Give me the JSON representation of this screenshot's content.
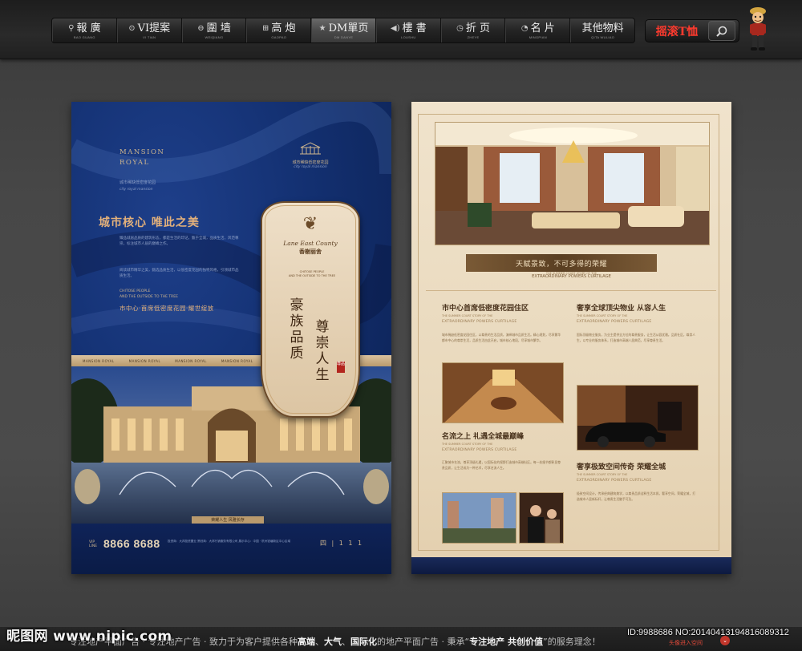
{
  "nav": {
    "items": [
      {
        "icon": "⚲",
        "icon_name": "location-pin-icon",
        "label": "報 廣",
        "sub": "BAO GUANG",
        "active": false
      },
      {
        "icon": "⊙",
        "icon_name": "vi-icon",
        "label": "VI提案",
        "sub": "VI TIAN",
        "active": false
      },
      {
        "icon": "⊖",
        "icon_name": "wall-icon",
        "label": "圍 墙",
        "sub": "WEIQIANG",
        "active": false
      },
      {
        "icon": "⊞",
        "icon_name": "grid-icon",
        "label": "高 炮",
        "sub": "GAOPAO",
        "active": false
      },
      {
        "icon": "★",
        "icon_name": "star-icon",
        "label": "DM單页",
        "sub": "DM DANYE",
        "active": true
      },
      {
        "icon": "◀)",
        "icon_name": "speaker-icon",
        "label": "樓 書",
        "sub": "LOUSHU",
        "active": false
      },
      {
        "icon": "◷",
        "icon_name": "fold-icon",
        "label": "折 页",
        "sub": "ZHEYE",
        "active": false
      },
      {
        "icon": "◔",
        "icon_name": "card-icon",
        "label": "名 片",
        "sub": "MINGPIAN",
        "active": false
      },
      {
        "icon": "",
        "icon_name": "",
        "label": "其他物料",
        "sub": "QITA WULIAO",
        "active": false
      }
    ]
  },
  "search": {
    "label": "摇滚T恤",
    "icon": "magnifier-icon"
  },
  "poster_left": {
    "brand": [
      "MANSION",
      "ROYAL"
    ],
    "brand_sub": "城市稀缺低密度花园",
    "brand_sub_en": "city royal mansion",
    "top_logo_cn": "城市稀缺低密度花园",
    "top_logo_en": "city royal mansion",
    "headline": "城市核心  唯此之美",
    "body1": "臻品城居品质的建筑形态，都是生活的印记，甄于全城，品质生活，风范尊崇，标注城市人居的巅峰之作。",
    "body2": "阅读城市精华之美，甄选品质生活，以低密度花园的独特风格，引领城市品质生活。",
    "en_lines": [
      "CHITOSE PEOPLE",
      "AND THE OUTSIDE TO THE TREE"
    ],
    "tagline": "市中心·首席低密度花园·耀世绽放",
    "strip": [
      "MANSION ROYAL",
      "MANSION ROYAL",
      "MANSION ROYAL",
      "MANSION ROYAL",
      "MANSION ROYAL",
      "MANSION ROYAL"
    ],
    "caption": "荣耀人生  风雅长存",
    "vip": "VIP LINE",
    "phone": "8866 8688",
    "info": "投资商：大邦投资置业    策划商：大邦行销服务有限公司    展示中心：中国 · 杭州钱塘新区中心区域",
    "bottom_logo": "四 | 1 1 1",
    "badge": {
      "emblem": "❦",
      "script": "Lane East County",
      "cn": "香榭丽舍",
      "en": [
        "CHITOSE PEOPLE",
        "AND THE OUTSIDE TO THE TREE"
      ],
      "v1": "豪族品质",
      "v2": "尊崇人生",
      "seal": "尊品"
    }
  },
  "poster_right": {
    "title": "天赋景致，不可多得的荣耀",
    "title_sub0": "THE SUMMER COURT STORY OF THE",
    "title_sub": "EXTRAORDINARY POWERS CURTILAGE",
    "sections": [
      {
        "heading": "市中心首席低密度花园住区",
        "en0": "THE SUMMER COURT STORY OF THE",
        "en": "EXTRAORDINARY POWERS CURTILAGE",
        "body": "城市稀缺低密度花园住区，以尊贵的生活品质，演绎城市品质生活。精心规划，尽享繁华都市中心的尊崇生活，品质生活由此开启，城市核心地段，尽享城市繁华。"
      },
      {
        "heading": "奢享全球顶尖物业 从容人生",
        "en0": "THE SUMMER COURT STORY OF THE",
        "en": "EXTRAORDINARY POWERS CURTILAGE",
        "body": "国际顶级物业服务，为业主提供全方位的尊贵服务，让生活从容优雅。品质社区，尊崇人生，以专业的服务体系，打造城市高端人居典范，尽享尊贵生活。"
      },
      {
        "heading": "名流之上 礼遇全城最巅峰",
        "en0": "THE SUMMER COURT STORY OF THE",
        "en": "EXTRAORDINARY POWERS CURTILAGE",
        "body": "汇聚城市名流，尊享顶级礼遇，以国际化的视野打造城市高端社区。每一处细节都彰显尊贵品质，让生活成为一种艺术，尽享名流人生。"
      },
      {
        "heading": "奢享极致空间传奇 荣耀全城",
        "en0": "THE SUMMER COURT STORY OF THE",
        "en": "EXTRAORDINARY POWERS CURTILAGE",
        "body": "极致空间设计，传承经典建筑美学，以尊贵品质诠释生活本质。奢享空间，荣耀全城，打造城市人居新标杆，让尊贵生活触手可及。"
      }
    ]
  },
  "footer": {
    "text_pre": "专注地产平面广告 · 专注地产广告 · 致力于为客户提供各种",
    "bold1": "高端",
    "sep1": "、",
    "bold2": "大气",
    "sep2": "、",
    "bold3": "国际化",
    "text_mid": "的地产平面广告 · 秉承“",
    "bold4": "专注地产  共创价值",
    "text_post": "”的服务理念！",
    "watermark_left": "昵图网 www.nipic.com",
    "watermark_right": "ID:9988686 NO:20140413194816089312",
    "mini": "头像进入空间",
    "arrow": "⌄"
  },
  "colors": {
    "left_navy": "#133071",
    "gold": "#e2b07b",
    "right_cream": "#f0e3cc",
    "badge_brown": "#3e2612"
  }
}
